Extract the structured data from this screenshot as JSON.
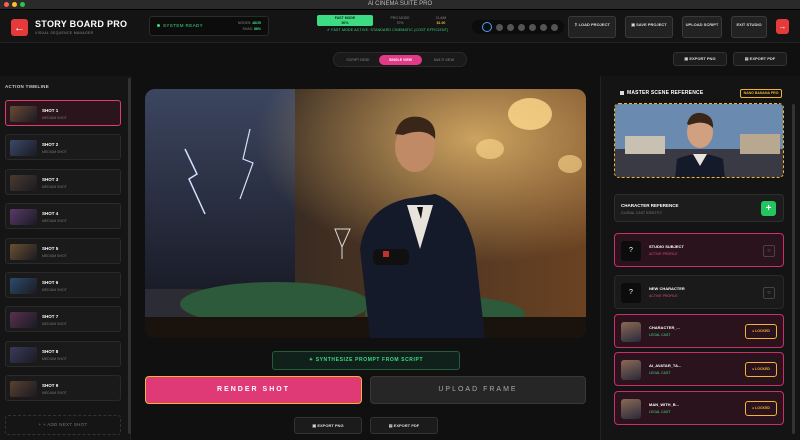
{
  "window": {
    "title": "AI CINEMA SUITE PRO"
  },
  "brand": {
    "title": "STORY BOARD PRO",
    "subtitle": "VISUAL SEQUENCE MANAGER"
  },
  "system": {
    "status": "SYSTEM READY",
    "stat1_label": "NODES:",
    "stat1_value": "48/25",
    "stat2_label": "SHAS:",
    "stat2_value": "88%"
  },
  "modes": {
    "fast_label": "FAST MODE",
    "fast_sub": "50%",
    "pro_label": "PRO MODE",
    "pro_sub": "70%",
    "credit_label": "CLAIM",
    "credit_value": "$1.00",
    "note": "FAST MODE ACTIVE: STANDARD CINEMATIC (COST EFFICIENT)"
  },
  "stepper": {
    "count": 7,
    "active": 0
  },
  "actions": {
    "load": "LOAD PROJECT",
    "save": "SAVE PROJECT",
    "upload": "UPLOAD SCRIPT",
    "exit": "EXIT STUDIO"
  },
  "exports_top": {
    "png": "EXPORT PNG",
    "pdf": "EXPORT PDF"
  },
  "timeline": {
    "title": "ACTION TIMELINE",
    "shots": [
      {
        "name": "SHOT 1",
        "meta": "MEDIUM SHOT",
        "color": "#6a4a35"
      },
      {
        "name": "SHOT 2",
        "meta": "MEDIUM SHOT",
        "color": "#3a4a6a"
      },
      {
        "name": "SHOT 3",
        "meta": "MEDIUM SHOT",
        "color": "#4a3a2e"
      },
      {
        "name": "SHOT 4",
        "meta": "MEDIUM SHOT",
        "color": "#5a3a6a"
      },
      {
        "name": "SHOT 5",
        "meta": "MEDIUM SHOT",
        "color": "#6a5030"
      },
      {
        "name": "SHOT 6",
        "meta": "MEDIUM SHOT",
        "color": "#2e4a6a"
      },
      {
        "name": "SHOT 7",
        "meta": "MEDIUM SHOT",
        "color": "#5a3050"
      },
      {
        "name": "SHOT 8",
        "meta": "MEDIUM SHOT",
        "color": "#3a3a5a"
      },
      {
        "name": "SHOT 9",
        "meta": "MEDIUM SHOT",
        "color": "#5a4030"
      }
    ],
    "add_label": "+ + ADD NEXT SHOT"
  },
  "view_tabs": {
    "script": "SCRIPT DESK",
    "single": "SINGLE VIEW",
    "multi": "MULTI VIEW"
  },
  "synth": {
    "label": "SYNTHESIZE PROMPT FROM SCRIPT"
  },
  "render": {
    "label": "RENDER SHOT"
  },
  "upload": {
    "label": "UPLOAD FRAME"
  },
  "exports_bottom": {
    "png": "EXPORT PNG",
    "pdf": "EXPORT PDF"
  },
  "reference": {
    "title": "MASTER SCENE REFERENCE",
    "badge": "NANO BANANA PRO",
    "char_title": "CHARACTER REFERENCE",
    "char_sub": "GLOBAL CAST IDENTITY",
    "cards": [
      {
        "name": "STUDIO SUBJECT",
        "status": "ACTIVE PROFILE",
        "glyph": "?"
      },
      {
        "name": "NEW CHARACTER",
        "status": "ACTIVE PROFILE",
        "glyph": "?"
      },
      {
        "name": "CHARACTER_...",
        "status": "LEGAL CAST",
        "lock": "LOCKED"
      },
      {
        "name": "AI_AVATAR_TA...",
        "status": "LEGAL CAST",
        "lock": "LOCKED"
      },
      {
        "name": "MAN_WITH_B...",
        "status": "LEGAL CAST",
        "lock": "LOCKED"
      }
    ]
  },
  "colors": {
    "accent_pink": "#e03a76",
    "accent_green": "#3ddc84",
    "accent_gold": "#f0b433",
    "danger": "#e53a3a"
  }
}
